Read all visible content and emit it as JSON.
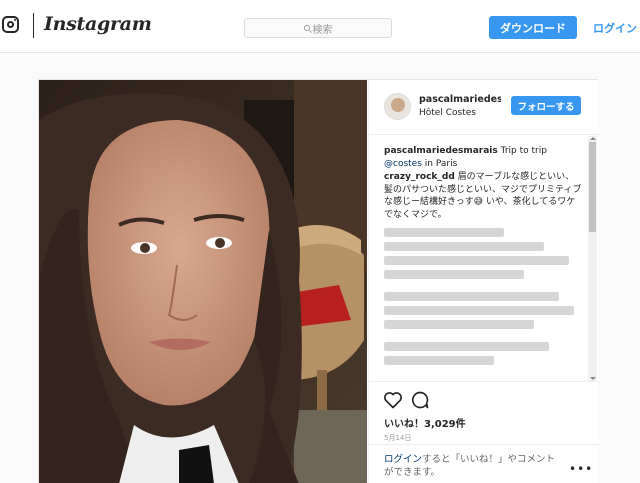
{
  "header": {
    "brand": "Instagram",
    "search_placeholder": "検索",
    "download_label": "ダウンロード",
    "login_label": "ログイン"
  },
  "post": {
    "username": "pascalmariedesmarais",
    "username_display": "pascalmariedesma",
    "location": "Hôtel Costes",
    "follow_label": "フォローする",
    "caption_text": "Trip to trip",
    "caption_mention": "@costes",
    "caption_rest": " in Paris",
    "comment_user": "crazy_rock_dd",
    "comment_text": " 眉のマーブルな感じといい、髪のパサついた感じといい、マジでプリミティブな感じー結構好きっす😅 いや、茶化してるワケでなくマジで。",
    "likes": "いいね！3,029件",
    "date": "5月14日",
    "login_prompt_link": "ログイン",
    "login_prompt_text": "すると「いいね！」やコメントができます。",
    "more_label": "•••"
  },
  "colors": {
    "accent": "#3897f0",
    "link": "#003569",
    "border": "#e6e6e6"
  }
}
